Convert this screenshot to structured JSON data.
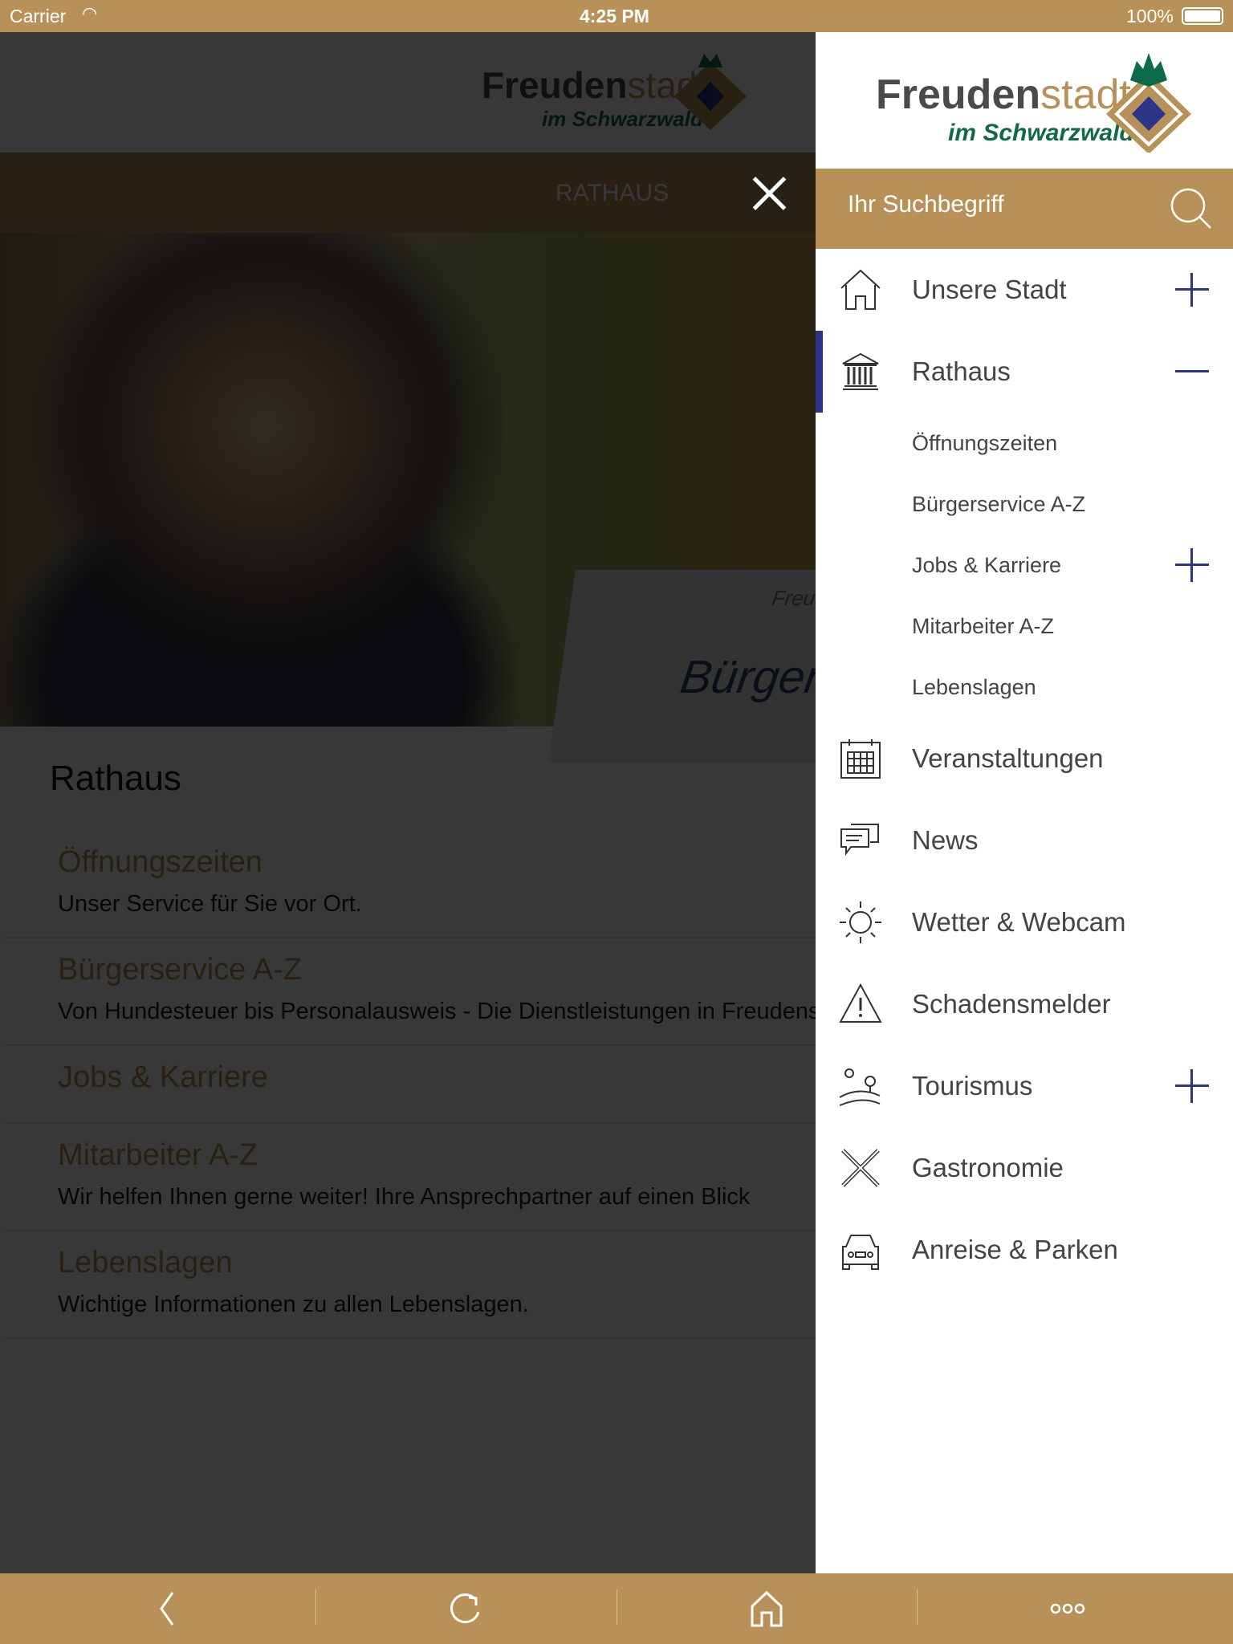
{
  "status_bar": {
    "carrier": "Carrier",
    "time": "4:25 PM",
    "battery": "100%"
  },
  "logo": {
    "name": "Freudenstadt",
    "tagline": "im Schwarzwald",
    "colors": {
      "dark": "#4a4a4a",
      "gold": "#b79157",
      "green": "#0e6b4a",
      "blue": "#2b3488"
    }
  },
  "page": {
    "section_bar": "RATHAUS",
    "hero_card_text": "Bürgers",
    "hero_card_logo": "Freude",
    "title": "Rathaus",
    "items": [
      {
        "title": "Öffnungszeiten",
        "desc": "Unser Service für Sie vor Ort."
      },
      {
        "title": "Bürgerservice A-Z",
        "desc": "Von Hundesteuer bis Personalausweis - Die Dienstleistungen in Freudenstadt"
      },
      {
        "title": "Jobs & Karriere",
        "desc": ""
      },
      {
        "title": "Mitarbeiter A-Z",
        "desc": "Wir helfen Ihnen gerne weiter! Ihre Ansprechpartner auf einen Blick"
      },
      {
        "title": "Lebenslagen",
        "desc": "Wichtige Informationen zu allen Lebenslagen."
      }
    ]
  },
  "drawer": {
    "search_placeholder": "Ihr Suchbegriff",
    "menu": [
      {
        "label": "Unsere Stadt",
        "icon": "home-icon",
        "expand": "plus"
      },
      {
        "label": "Rathaus",
        "icon": "town-hall-icon",
        "expand": "minus",
        "active": true
      },
      {
        "label": "Öffnungszeiten",
        "sub": true
      },
      {
        "label": "Bürgerservice A-Z",
        "sub": true
      },
      {
        "label": "Jobs & Karriere",
        "sub": true,
        "expand": "plus"
      },
      {
        "label": "Mitarbeiter A-Z",
        "sub": true
      },
      {
        "label": "Lebenslagen",
        "sub": true
      },
      {
        "label": "Veranstaltungen",
        "icon": "calendar-icon"
      },
      {
        "label": "News",
        "icon": "chat-icon"
      },
      {
        "label": "Wetter & Webcam",
        "icon": "sun-icon"
      },
      {
        "label": "Schadensmelder",
        "icon": "warning-icon"
      },
      {
        "label": "Tourismus",
        "icon": "landscape-icon",
        "expand": "plus"
      },
      {
        "label": "Gastronomie",
        "icon": "cutlery-icon"
      },
      {
        "label": "Anreise & Parken",
        "icon": "car-icon"
      }
    ]
  },
  "toolbar": [
    "back-icon",
    "reload-icon",
    "home-icon",
    "more-icon"
  ],
  "accent": "#b79157",
  "active_color": "#2b3488"
}
